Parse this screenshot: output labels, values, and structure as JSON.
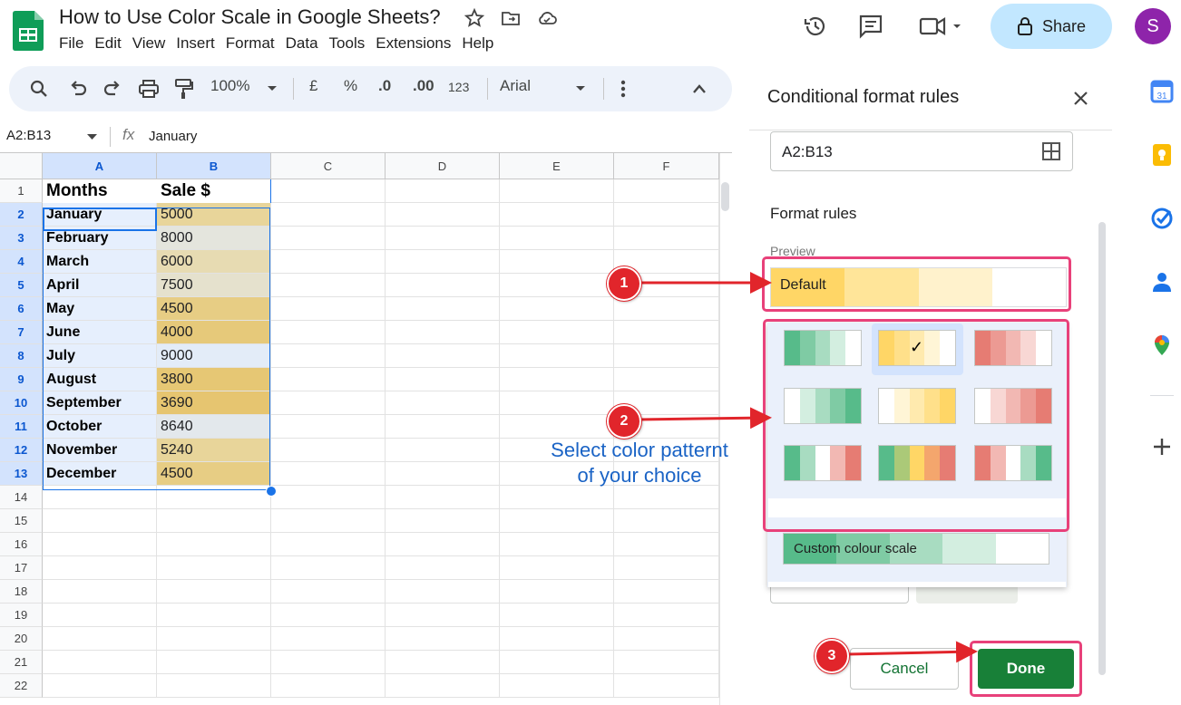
{
  "app": {
    "doc_title": "How to Use Color Scale in Google Sheets?",
    "menu": [
      "File",
      "Edit",
      "View",
      "Insert",
      "Format",
      "Data",
      "Tools",
      "Extensions",
      "Help"
    ],
    "share_label": "Share",
    "avatar_letter": "S"
  },
  "toolbar": {
    "zoom": "100%",
    "currency": "£",
    "percent": "%",
    "dec_decrease": ".0",
    "dec_increase": ".00",
    "number_format": "123",
    "font": "Arial"
  },
  "formula_bar": {
    "name_box": "A2:B13",
    "fx": "fx",
    "value": "January"
  },
  "sheet": {
    "columns": [
      "A",
      "B",
      "C",
      "D",
      "E",
      "F"
    ],
    "rows": [
      "1",
      "2",
      "3",
      "4",
      "5",
      "6",
      "7",
      "8",
      "9",
      "10",
      "11",
      "12",
      "13",
      "14",
      "15",
      "16",
      "17",
      "18",
      "19",
      "20",
      "21",
      "22"
    ],
    "header": [
      "Months",
      "Sale $"
    ],
    "data": [
      {
        "month": "January",
        "sale": "5000",
        "color": "#e8d59a"
      },
      {
        "month": "February",
        "sale": "8000",
        "color": "#e4e5dd"
      },
      {
        "month": "March",
        "sale": "6000",
        "color": "#e7dbb2"
      },
      {
        "month": "April",
        "sale": "7500",
        "color": "#e5e1cd"
      },
      {
        "month": "May",
        "sale": "4500",
        "color": "#e7cd84"
      },
      {
        "month": "June",
        "sale": "4000",
        "color": "#e6c97a"
      },
      {
        "month": "July",
        "sale": "9000",
        "color": "#e3ecf8"
      },
      {
        "month": "August",
        "sale": "3800",
        "color": "#e6c774"
      },
      {
        "month": "September",
        "sale": "3690",
        "color": "#e6c570"
      },
      {
        "month": "October",
        "sale": "8640",
        "color": "#e3e8ec"
      },
      {
        "month": "November",
        "sale": "5240",
        "color": "#e8d59a"
      },
      {
        "month": "December",
        "sale": "4500",
        "color": "#e7cd84"
      }
    ]
  },
  "panel": {
    "title": "Conditional format rules",
    "range": "A2:B13",
    "format_rules_label": "Format rules",
    "preview_label": "Preview",
    "preview_text": "Default",
    "preview_colors": [
      "#ffd666",
      "#ffe599",
      "#fff2cc",
      "#ffffff"
    ],
    "checkmark": "✓",
    "swatches": [
      [
        "#57bb8a",
        "#7fcba4",
        "#a8dcc1",
        "#d3eee0",
        "#ffffff"
      ],
      [
        "#ffd666",
        "#ffe08a",
        "#ffeaae",
        "#fff5d6",
        "#ffffff"
      ],
      [
        "#e67c73",
        "#ec9a93",
        "#f2b8b3",
        "#f8d7d4",
        "#ffffff"
      ],
      [
        "#ffffff",
        "#d3eee0",
        "#a8dcc1",
        "#7fcba4",
        "#57bb8a"
      ],
      [
        "#ffffff",
        "#fff5d6",
        "#ffeaae",
        "#ffe08a",
        "#ffd666"
      ],
      [
        "#ffffff",
        "#f8d7d4",
        "#f2b8b3",
        "#ec9a93",
        "#e67c73"
      ],
      [
        "#57bb8a",
        "#a8dcc1",
        "#ffffff",
        "#f2b8b3",
        "#e67c73"
      ],
      [
        "#57bb8a",
        "#abc978",
        "#ffd666",
        "#f4a66d",
        "#e67c73"
      ],
      [
        "#e67c73",
        "#f2b8b3",
        "#ffffff",
        "#a8dcc1",
        "#57bb8a"
      ]
    ],
    "custom_scale_label": "Custom colour scale",
    "custom_scale_colors": [
      "#57bb8a",
      "#7fcba4",
      "#a8dcc1",
      "#d3eee0",
      "#ffffff"
    ],
    "cancel_label": "Cancel",
    "done_label": "Done"
  },
  "annotations": {
    "badge_1": "1",
    "badge_2": "2",
    "badge_3": "3",
    "text_line1": "Select color patternt",
    "text_line2": "of your choice"
  }
}
